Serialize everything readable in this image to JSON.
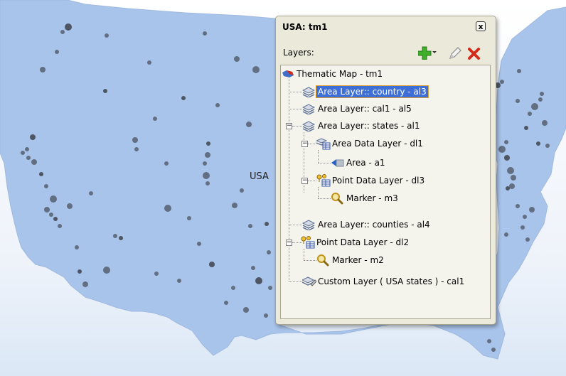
{
  "map": {
    "label": "USA",
    "colors": {
      "land": "#a9c4ea",
      "land_edge": "#9fb9e0",
      "dot": "#444a55",
      "sky_top": "#ffffff",
      "sky_bottom": "#dbe7f6"
    }
  },
  "popup": {
    "title": "USA: tm1",
    "close_label": "x",
    "layers_label": "Layers:",
    "toolbar": {
      "add_icon": "add-plus-icon",
      "edit_icon": "pencil-icon",
      "delete_icon": "delete-x-icon"
    },
    "tree": {
      "root": "Thematic Map - tm1",
      "n1": "Area Layer:: country - al3",
      "n2": "Area Layer:: cal1 - al5",
      "n3": "Area Layer:: states - al1",
      "n3a": "Area Data Layer - dl1",
      "n3a1": "Area - a1",
      "n3b": "Point Data Layer - dl3",
      "n3b1": "Marker - m3",
      "n4": "Area Layer:: counties - al4",
      "n5": "Point Data Layer - dl2",
      "n5a": "Marker - m2",
      "n6": "Custom Layer ( USA states ) - cal1"
    }
  }
}
